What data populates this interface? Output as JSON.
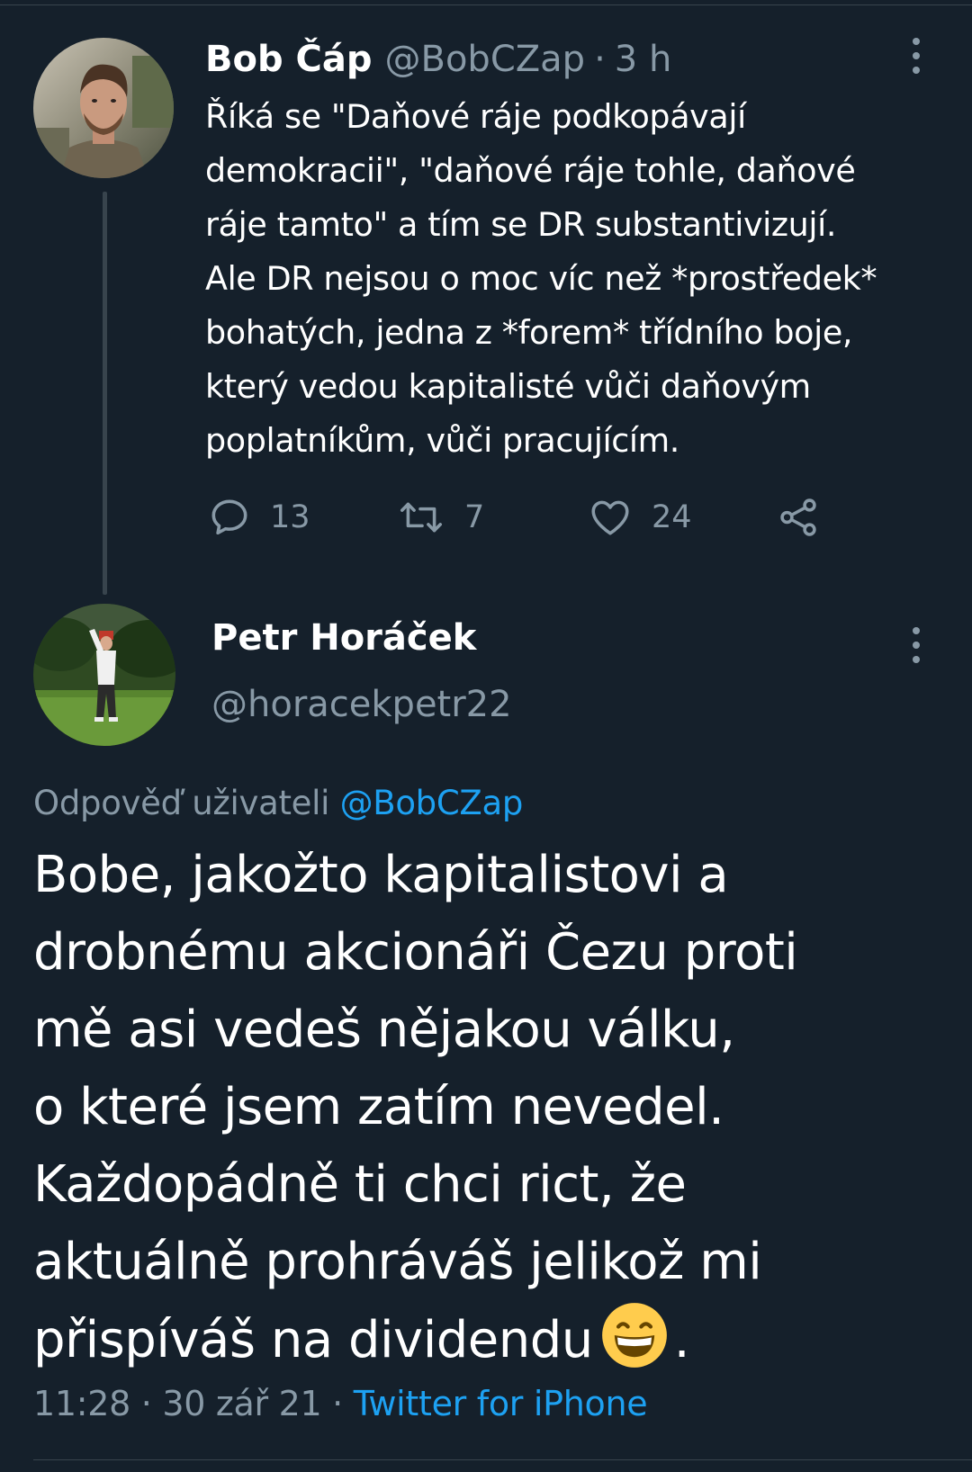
{
  "thread": {
    "parent": {
      "author_name": "Bob Čáp",
      "handle": "@BobCZap",
      "separator": "·",
      "time": "3 h",
      "text_lines": [
        "Říká se \"Daňové ráje podkopávají",
        "demokracii\", \"daňové ráje tohle, daňové",
        "ráje tamto\" a tím se DR substantivizují.",
        "Ale DR nejsou o moc víc než *prostředek*",
        "bohatých, jedna z *forem* třídního boje,",
        "který vedou kapitalisté vůči daňovým",
        "poplatníkům, vůči pracujícím."
      ],
      "actions": {
        "reply_count": "13",
        "retweet_count": "7",
        "like_count": "24"
      }
    },
    "reply": {
      "author_name": "Petr Horáček",
      "handle": "@horacekpetr22",
      "reply_to_prefix": "Odpověď uživateli",
      "reply_to_handle": "@BobCZap",
      "text_lines": [
        "Bobe, jakožto kapitalistovi a",
        "drobnému akcionáři Čezu proti",
        "mě asi vedeš nějakou válku,",
        "o které jsem zatím nevedel.",
        "Každopádně  ti chci rict, že",
        "aktuálně prohráváš jelikož mi",
        "přispíváš na dividendu"
      ],
      "text_end": ".",
      "emoji": "grinning-face-with-smiling-eyes",
      "time": "11:28",
      "date": "30 zář 21",
      "meta_separator": "·",
      "source": "Twitter for iPhone"
    }
  },
  "colors": {
    "background": "#15202b",
    "text_primary": "#ffffff",
    "text_secondary": "#8899a6",
    "link": "#1da1f2",
    "divider": "#38444d"
  },
  "icons": {
    "reply": "speech-bubble-icon",
    "retweet": "retweet-icon",
    "like": "heart-icon",
    "share": "share-icon",
    "more": "vertical-ellipsis-icon"
  }
}
